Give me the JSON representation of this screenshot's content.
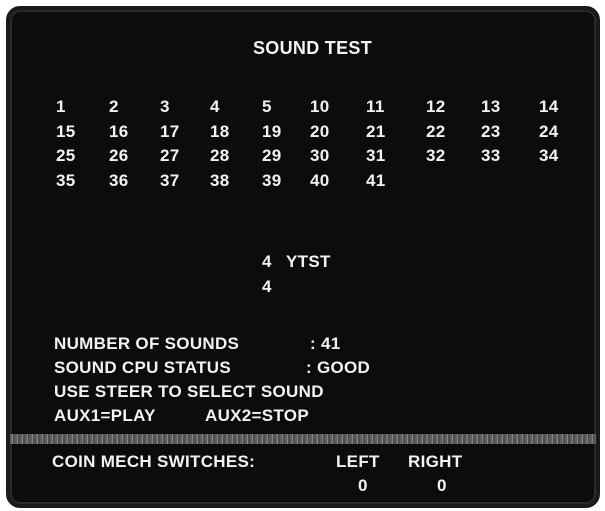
{
  "title": "SOUND TEST",
  "sounds": [
    "1",
    "2",
    "3",
    "4",
    "5",
    "10",
    "11",
    "12",
    "13",
    "14",
    "15",
    "16",
    "17",
    "18",
    "19",
    "20",
    "21",
    "22",
    "23",
    "24",
    "25",
    "26",
    "27",
    "28",
    "29",
    "30",
    "31",
    "32",
    "33",
    "34",
    "35",
    "36",
    "37",
    "38",
    "39",
    "40",
    "41"
  ],
  "selection": {
    "line1_number": "4",
    "line1_label": "YTST",
    "line2_number": "4"
  },
  "status": {
    "num_sounds_label": "NUMBER OF SOUNDS",
    "num_sounds_value": ": 41",
    "cpu_status_label": "SOUND CPU STATUS",
    "cpu_status_value": ": GOOD",
    "instruction": "USE STEER TO SELECT SOUND",
    "aux1": "AUX1=PLAY",
    "aux2": "AUX2=STOP"
  },
  "coin_mech": {
    "label": "COIN MECH SWITCHES:",
    "left_label": "LEFT",
    "right_label": "RIGHT",
    "left_value": "0",
    "right_value": "0"
  }
}
